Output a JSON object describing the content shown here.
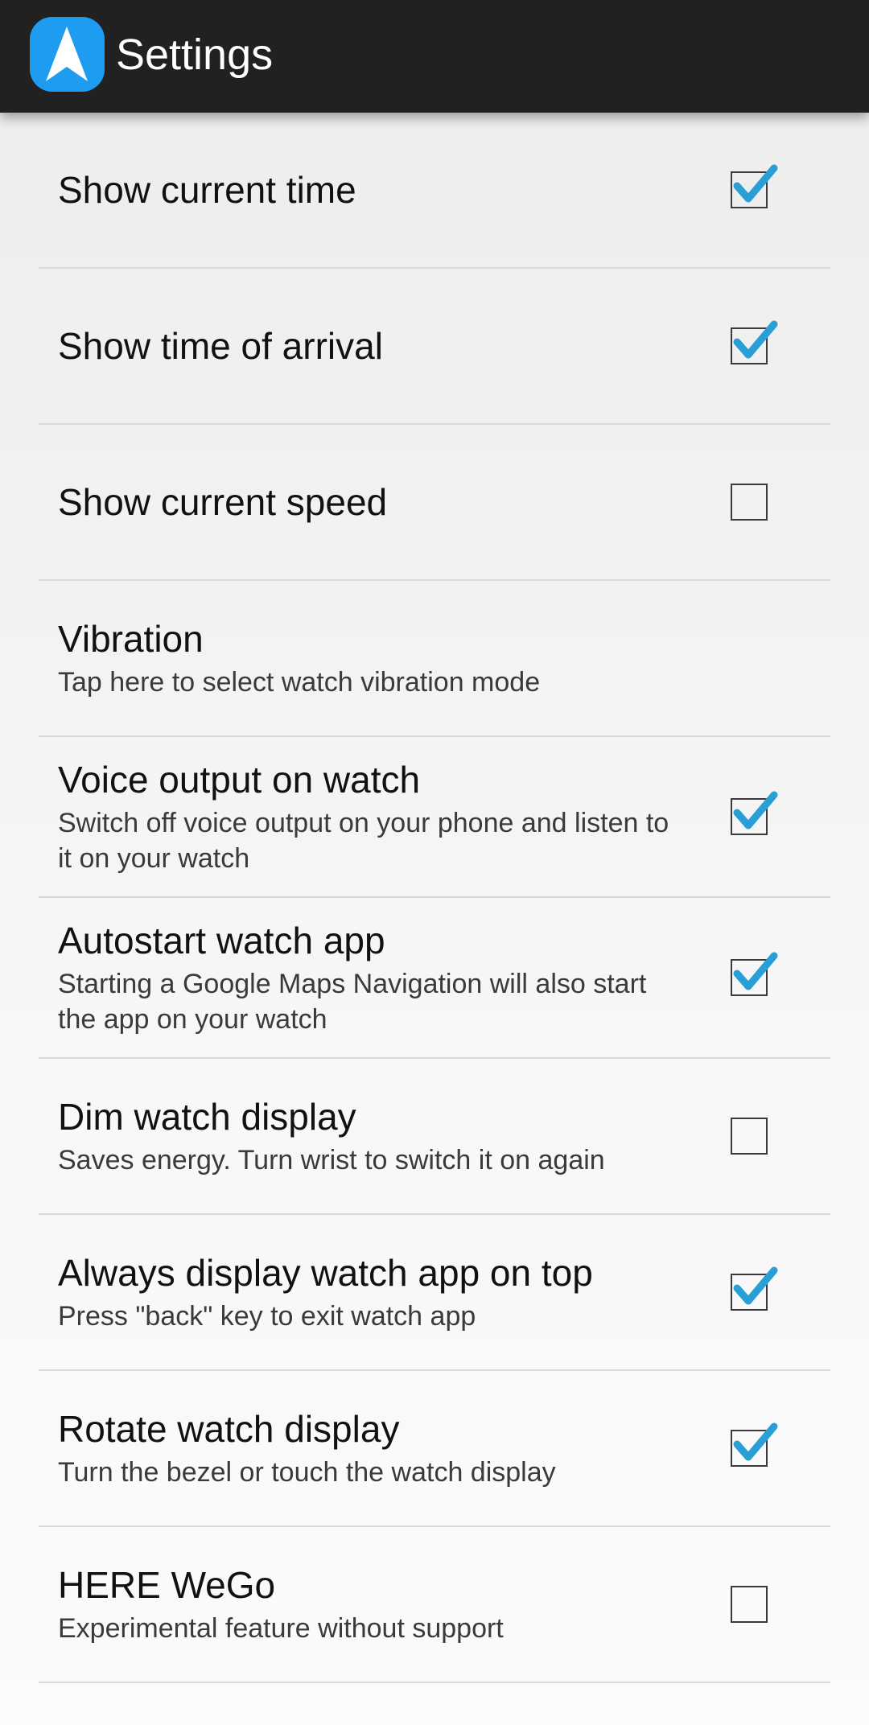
{
  "appbar": {
    "title": "Settings",
    "icon": "navigation-arrow-icon",
    "icon_color": "#1e9cf0"
  },
  "settings": [
    {
      "title": "Show current time",
      "subtitle": "",
      "checkbox": true,
      "checked": true
    },
    {
      "title": "Show time of arrival",
      "subtitle": "",
      "checkbox": true,
      "checked": true
    },
    {
      "title": "Show current speed",
      "subtitle": "",
      "checkbox": true,
      "checked": false
    },
    {
      "title": "Vibration",
      "subtitle": "Tap here to select watch vibration mode",
      "checkbox": false,
      "checked": false
    },
    {
      "title": "Voice output on watch",
      "subtitle": "Switch off voice output on your phone and listen to it on your watch",
      "checkbox": true,
      "checked": true
    },
    {
      "title": "Autostart watch app",
      "subtitle": "Starting a Google Maps Navigation will also start the app on your watch",
      "checkbox": true,
      "checked": true
    },
    {
      "title": "Dim watch display",
      "subtitle": "Saves energy. Turn wrist to switch it on again",
      "checkbox": true,
      "checked": false
    },
    {
      "title": "Always display watch app on top",
      "subtitle": "Press \"back\" key to exit watch app",
      "checkbox": true,
      "checked": true
    },
    {
      "title": "Rotate watch display",
      "subtitle": "Turn the bezel or touch the watch display",
      "checkbox": true,
      "checked": true
    },
    {
      "title": "HERE WeGo",
      "subtitle": "Experimental feature without support",
      "checkbox": true,
      "checked": false
    }
  ],
  "colors": {
    "appbar_bg": "#212121",
    "check_accent": "#2a9fd6"
  }
}
